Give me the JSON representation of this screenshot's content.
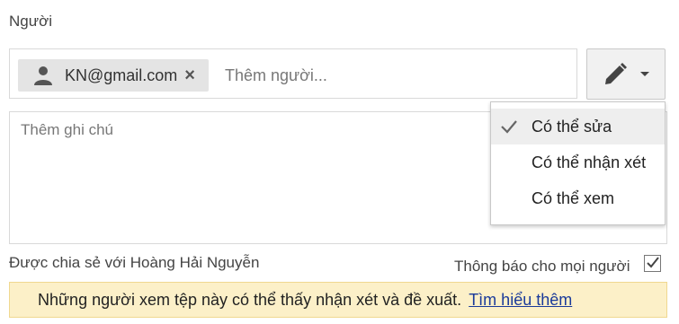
{
  "section_label": "Người",
  "chip": {
    "icon": "person-icon",
    "label": "KN@gmail.com",
    "remove_label": "×"
  },
  "add_people_placeholder": "Thêm người...",
  "permission_button": {
    "icon": "pencil-icon",
    "caret_icon": "caret-down-icon"
  },
  "note_placeholder": "Thêm ghi chú",
  "permission_menu": {
    "items": [
      {
        "label": "Có thể sửa",
        "selected": true
      },
      {
        "label": "Có thể nhận xét",
        "selected": false
      },
      {
        "label": "Có thể xem",
        "selected": false
      }
    ]
  },
  "shared_with_text": "Được chia sẻ với Hoàng Hải Nguyễn",
  "notify": {
    "label": "Thông báo cho mọi người",
    "checked": true
  },
  "banner": {
    "text": "Những người xem tệp này có thể thấy nhận xét và đề xuất.",
    "link_label": "Tìm hiểu thêm"
  },
  "colors": {
    "banner_bg": "#fcf0c8",
    "link": "#1a3a9a",
    "chip_bg": "#e4e4e4"
  }
}
